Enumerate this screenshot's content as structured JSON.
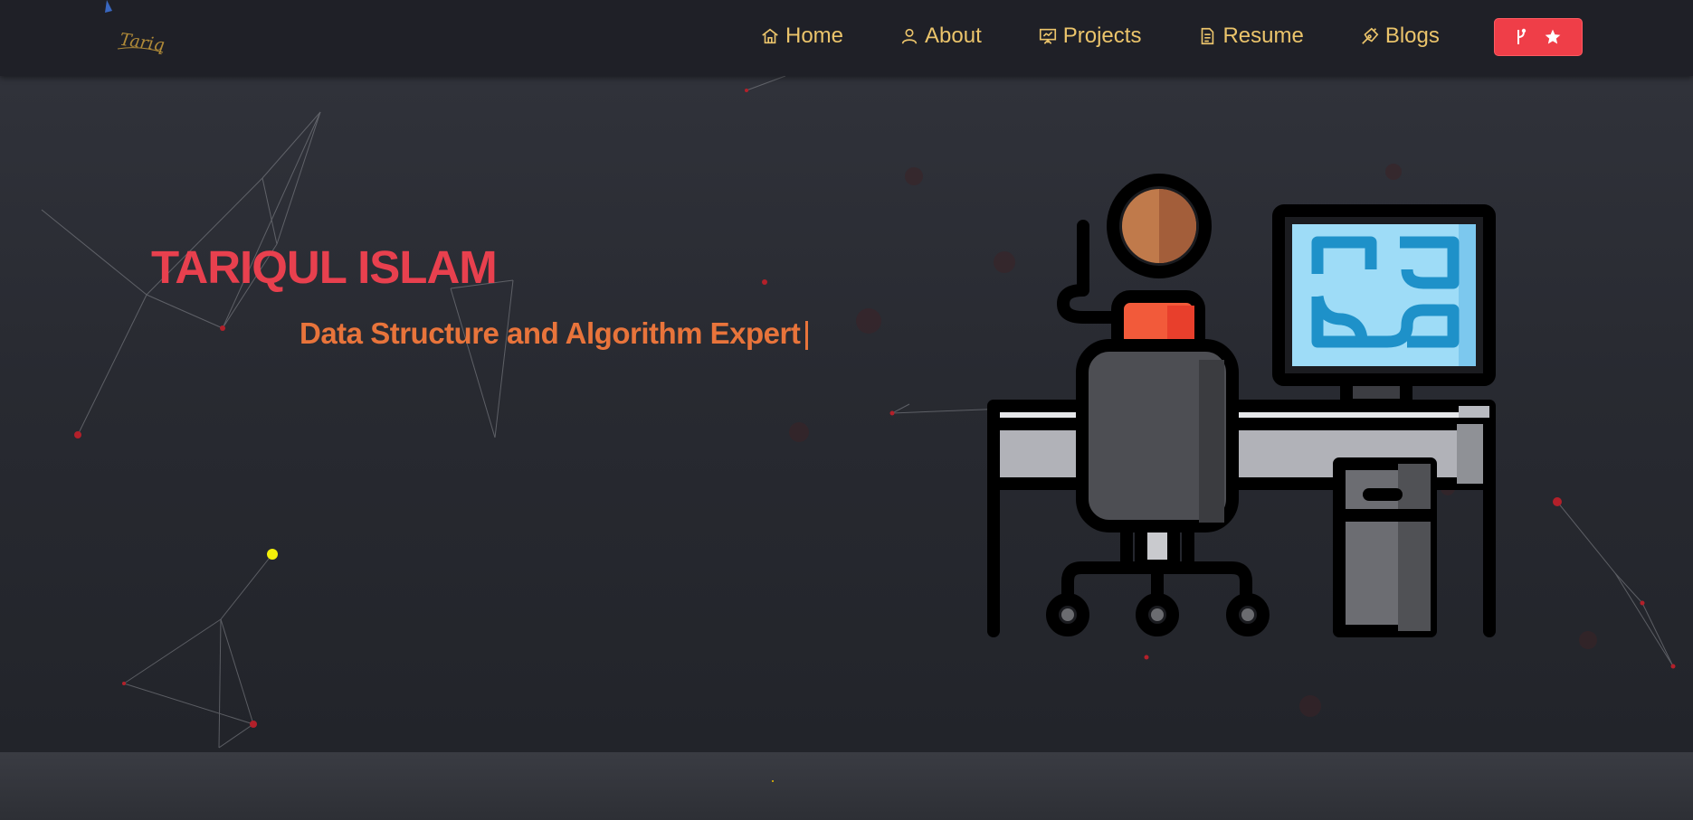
{
  "logo": {
    "signature": "Tariq"
  },
  "nav": {
    "items": [
      {
        "label": "Home",
        "icon": "home-icon"
      },
      {
        "label": "About",
        "icon": "user-icon"
      },
      {
        "label": "Projects",
        "icon": "presentation-icon"
      },
      {
        "label": "Resume",
        "icon": "document-icon"
      },
      {
        "label": "Blogs",
        "icon": "pen-nib-icon"
      }
    ],
    "github_button": {
      "icons": [
        "git-fork-icon",
        "star-icon"
      ],
      "color": "#ef3e48"
    }
  },
  "hero": {
    "name": "TARIQUL ISLAM",
    "typed_text": "Data Structure and Algorithm Expert",
    "illustration": "developer-at-desk-illustration"
  },
  "colors": {
    "background": "#25272e",
    "navbar": "#1f2027",
    "nav_text": "#ebc46b",
    "name": "#e8404e",
    "subtitle": "#e8743b",
    "accent_button": "#ef3e48"
  }
}
